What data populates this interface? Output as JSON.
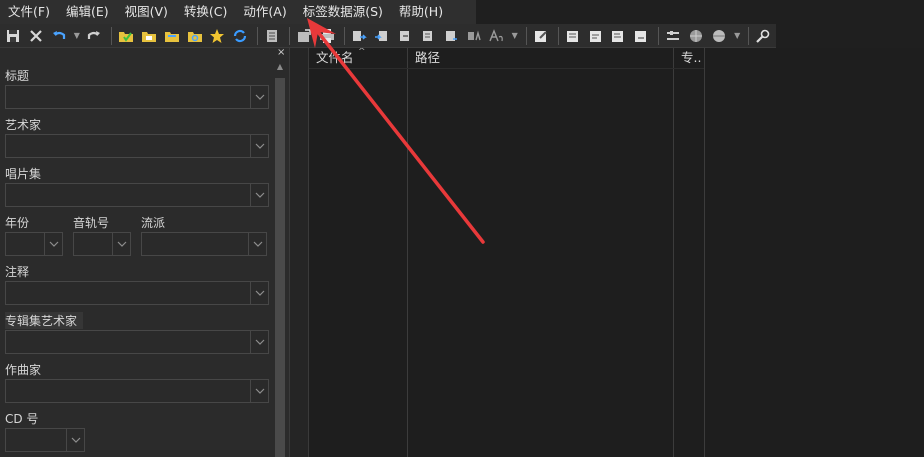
{
  "menu": {
    "items": [
      {
        "label": "文件(F)"
      },
      {
        "label": "编辑(E)"
      },
      {
        "label": "视图(V)"
      },
      {
        "label": "转换(C)"
      },
      {
        "label": "动作(A)"
      },
      {
        "label": "标签数据源(S)"
      },
      {
        "label": "帮助(H)"
      }
    ]
  },
  "toolbar": {
    "icons": [
      "save-icon",
      "delete-icon",
      "undo-icon",
      "redo-icon",
      "open-folder-icon",
      "refresh-icon",
      "favorite-icon",
      "sync-icon",
      "list-icon",
      "export-icon",
      "print-icon",
      "tag-icon",
      "tools-icon"
    ]
  },
  "panel": {
    "close_glyph": "×",
    "fields": {
      "title": "标题",
      "artist": "艺术家",
      "album": "唱片集",
      "year": "年份",
      "track": "音轨号",
      "genre": "流派",
      "comment": "注释",
      "album_artist": "专辑集艺术家",
      "composer": "作曲家",
      "cd": "CD 号"
    }
  },
  "list": {
    "columns": [
      {
        "label": "文件名"
      },
      {
        "label": "路径"
      },
      {
        "label": "专.."
      }
    ]
  },
  "colors": {
    "background": "#1e1e1e",
    "panel": "#2b2b2b",
    "annotation_arrow": "#e8393a"
  }
}
